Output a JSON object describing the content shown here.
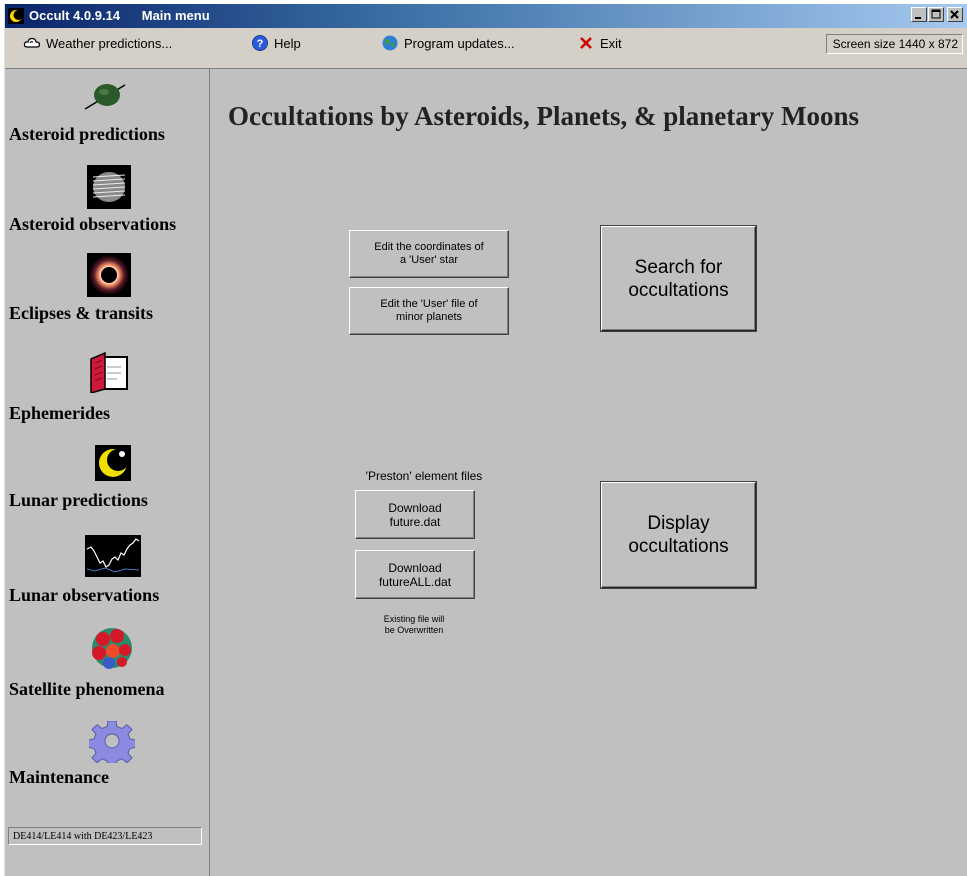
{
  "window": {
    "title_app": "Occult 4.0.9.14",
    "title_sub": "Main menu"
  },
  "menubar": {
    "weather": "Weather predictions...",
    "help": "Help",
    "updates": "Program updates...",
    "exit": "Exit",
    "screen_size": "Screen size 1440 x 872"
  },
  "sidebar": {
    "items": [
      {
        "label": "Asteroid predictions",
        "icon": "asteroid-icon"
      },
      {
        "label": "Asteroid observations",
        "icon": "asteroid-profile-icon"
      },
      {
        "label": "Eclipses & transits",
        "icon": "eclipse-icon"
      },
      {
        "label": "Ephemerides",
        "icon": "book-icon"
      },
      {
        "label": "Lunar predictions",
        "icon": "moon-icon"
      },
      {
        "label": "Lunar observations",
        "icon": "light-curve-icon"
      },
      {
        "label": "Satellite phenomena",
        "icon": "satellites-icon"
      },
      {
        "label": "Maintenance",
        "icon": "gear-icon"
      }
    ],
    "ephemeris_status": "DE414/LE414 with DE423/LE423"
  },
  "main": {
    "title": "Occultations by Asteroids, Planets, & planetary Moons",
    "edit_user_star": "Edit the coordinates of\na 'User' star",
    "edit_user_file": "Edit the 'User' file of\nminor planets",
    "search": "Search for\noccultations",
    "preston_label": "'Preston' element files",
    "download_future": "Download\nfuture.dat",
    "download_future_all": "Download\nfutureALL.dat",
    "overwrite_note": "Existing file will\nbe Overwritten",
    "display": "Display\noccultations"
  },
  "colors": {
    "background": "#c0c0c0",
    "titlebar_start": "#0a246a",
    "titlebar_end": "#a6caf0",
    "exit_icon": "#cc0000"
  }
}
